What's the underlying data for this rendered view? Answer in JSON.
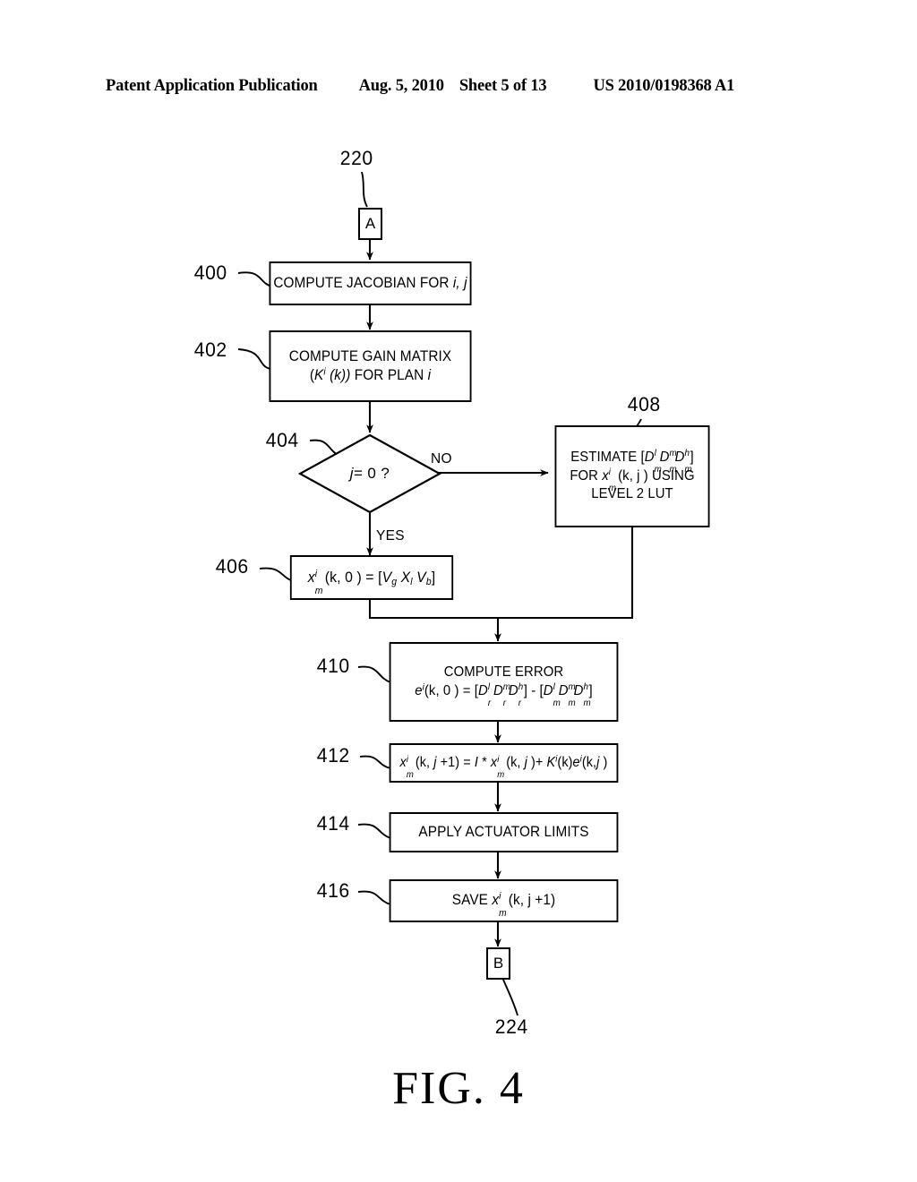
{
  "header": {
    "publication": "Patent Application Publication",
    "date": "Aug. 5, 2010",
    "sheet": "Sheet 5 of 13",
    "patent_number": "US 2010/0198368 A1"
  },
  "figure": {
    "caption": "FIG. 4"
  },
  "connectors": {
    "entry": {
      "label": "A",
      "ref": "220"
    },
    "exit": {
      "label": "B",
      "ref": "224"
    }
  },
  "edge_labels": {
    "no": "NO",
    "yes": "YES"
  },
  "nodes": [
    {
      "ref": "400",
      "type": "process",
      "text": "COMPUTE JACOBIAN FOR i, j",
      "lines": [
        "COMPUTE JACOBIAN FOR i, j"
      ]
    },
    {
      "ref": "402",
      "type": "process",
      "text": "COMPUTE GAIN MATRIX (K^i (k)) FOR PLAN i",
      "lines": [
        "COMPUTE GAIN MATRIX",
        "(K i (k)) FOR PLAN i"
      ]
    },
    {
      "ref": "404",
      "type": "decision",
      "text": "j = 0 ?",
      "lines": [
        "j = 0 ?"
      ]
    },
    {
      "ref": "406",
      "type": "process",
      "text": "x_m^i (k, 0) = [Vg Xl Vb]",
      "lines": [
        "x m i (k, 0 ) = [Vg Xl Vb]"
      ]
    },
    {
      "ref": "408",
      "type": "process",
      "text": "ESTIMATE [Dm^l Dm^m Dm^h] FOR x_m^i (k, j) USING LEVEL 2 LUT",
      "lines": [
        "ESTIMATE [Dm l Dm m Dm h]",
        "FOR x m i (k, j ) USING",
        "LEVEL 2 LUT"
      ]
    },
    {
      "ref": "410",
      "type": "process",
      "text": "COMPUTE ERROR e^i(k, 0) = [Dr^l Dr^m Dr^h] - [Dm^l Dm^m Dm^h]",
      "lines": [
        "COMPUTE ERROR",
        "e i(k, 0 ) = [Dr l Dr m Dr h] - [Dm l Dm m Dm h]"
      ]
    },
    {
      "ref": "412",
      "type": "process",
      "text": "x_m^i (k, j +1) = I * x_m^i (k, j) + K^i(k)e^i(k,j)",
      "lines": [
        "x m i (k, j +1) = I * x m i (k, j ) + K i(k)e i(k,j )"
      ]
    },
    {
      "ref": "414",
      "type": "process",
      "text": "APPLY ACTUATOR LIMITS",
      "lines": [
        "APPLY ACTUATOR LIMITS"
      ]
    },
    {
      "ref": "416",
      "type": "process",
      "text": "SAVE x_m^i (k, j +1)",
      "lines": [
        "SAVE x m i (k, j +1)"
      ]
    }
  ],
  "labels": {
    "n400": "400",
    "n402": "402",
    "n404": "404",
    "n406": "406",
    "n408": "408",
    "n410": "410",
    "n412": "412",
    "n414": "414",
    "n416": "416",
    "n220": "220",
    "n224": "224",
    "connA": "A",
    "connB": "B"
  },
  "node_text": {
    "b400": "COMPUTE JACOBIAN FOR",
    "b400_vars": "i, j",
    "b402_l1": "COMPUTE GAIN MATRIX",
    "b402_l2_open": "(",
    "b402_l2_K": "K",
    "b402_l2_sup": "i",
    "b402_l2_k": " (k))",
    "b402_l2_tail": " FOR PLAN ",
    "b402_l2_i": "i",
    "b404": "j",
    "b404_rest": " = 0 ?",
    "b406_x": "x",
    "b406_paren": " (k, 0 ) = [",
    "b406_V1": "V",
    "b406_g": "g",
    "b406_X": " X",
    "b406_l": "l",
    "b406_V2": " V",
    "b406_b": "b",
    "b406_close": "]",
    "b408_l1a": "ESTIMATE [",
    "b408_D": "D",
    "b408_l3": "LEVEL 2 LUT",
    "b408_l2a": "FOR ",
    "b408_l2b": " (k, j ) USING",
    "b410_l1": "COMPUTE ERROR",
    "b410_e": "e",
    "b410_kz": "(k, 0 ) = [",
    "b412_eq": " = ",
    "b412_I": "I",
    "b414": "APPLY ACTUATOR LIMITS",
    "b416_save": "SAVE ",
    "b416_tail": " (k, j +1)"
  },
  "colors": {
    "ink": "#000000",
    "paper": "#ffffff"
  }
}
